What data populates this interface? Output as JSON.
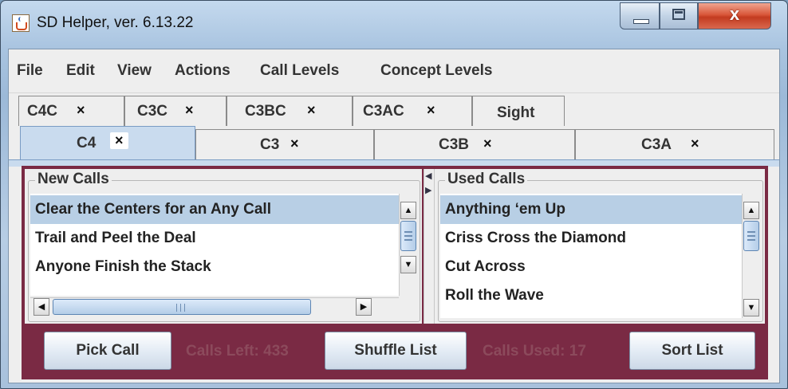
{
  "window": {
    "title": "SD Helper, ver. 6.13.22",
    "app_icon": "java-cup-icon",
    "controls": {
      "close_glyph": "x"
    }
  },
  "menu": [
    "File",
    "Edit",
    "View",
    "Actions",
    "Call Levels",
    "Concept Levels"
  ],
  "tabs_back_row": [
    {
      "label": "C4C",
      "close": "×"
    },
    {
      "label": "C3C",
      "close": "×"
    },
    {
      "label": "C3BC",
      "close": "×"
    },
    {
      "label": "C3AC",
      "close": "×"
    },
    {
      "label": "Sight",
      "close": ""
    }
  ],
  "tabs_front_row": [
    {
      "label": "C4",
      "close": "×",
      "selected": true
    },
    {
      "label": "C3",
      "close": "×"
    },
    {
      "label": "C3B",
      "close": "×"
    },
    {
      "label": "C3A",
      "close": "×"
    }
  ],
  "new_calls": {
    "title": "New Calls",
    "items": [
      "Clear the Centers for an Any Call",
      "Trail and Peel the Deal",
      "Anyone Finish the Stack"
    ],
    "selected_index": 0
  },
  "used_calls": {
    "title": "Used Calls",
    "items": [
      "Anything ‘em Up",
      "Criss Cross the Diamond",
      "Cut Across",
      "Roll the Wave"
    ],
    "selected_index": 0
  },
  "buttons": {
    "pick": "Pick Call",
    "shuffle": "Shuffle List",
    "sort": "Sort List"
  },
  "status": {
    "calls_left": "Calls Left: 433",
    "calls_used": "Calls Used: 17"
  },
  "colors": {
    "content_background": "#7a2a44",
    "status_text": "#8c4a5c",
    "selection": "#b8cfe5",
    "selected_tab": "#c9dbee"
  },
  "icons": {
    "scroll_up": "▲",
    "scroll_down": "▼",
    "scroll_left": "◀",
    "scroll_right": "▶",
    "tab_close": "×"
  }
}
